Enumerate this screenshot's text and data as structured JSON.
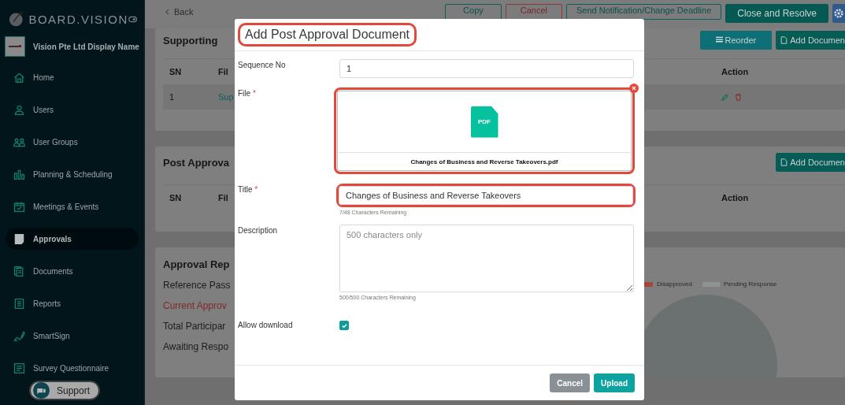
{
  "sidebar": {
    "brand": "BOARD.VISION",
    "org_name": "Vision Pte Ltd Display Name",
    "items": [
      {
        "label": "Home",
        "selected": false
      },
      {
        "label": "Users",
        "selected": false
      },
      {
        "label": "User Groups",
        "selected": false
      },
      {
        "label": "Planning & Scheduling",
        "selected": false
      },
      {
        "label": "Meetings & Events",
        "selected": false
      },
      {
        "label": "Approvals",
        "selected": true
      },
      {
        "label": "Documents",
        "selected": false
      },
      {
        "label": "Reports",
        "selected": false
      },
      {
        "label": "SmartSign",
        "selected": false
      },
      {
        "label": "Survey Questionnaire",
        "selected": false
      }
    ],
    "support_button": "Support"
  },
  "top_bar": {
    "back": "Back",
    "buttons": [
      {
        "label": "Copy",
        "kind": "outline"
      },
      {
        "label": "Cancel",
        "kind": "danger"
      },
      {
        "label": "Send Notification/Change Deadline",
        "kind": "outline"
      },
      {
        "label": "Close and Resolve",
        "kind": "solid"
      }
    ]
  },
  "supporting_documents": {
    "title": "Supporting",
    "buttons": [
      "Reorder",
      "Add Documen"
    ],
    "columns": [
      "SN",
      "Fil",
      "Action"
    ],
    "rows": [
      {
        "sn": "1",
        "file": "Sup"
      }
    ]
  },
  "post_approval_documents": {
    "title": "Post Approva",
    "button": "Add Documen",
    "columns": [
      "SN",
      "Fil",
      "Action"
    ]
  },
  "approval_report": {
    "title": "Approval Rep",
    "lines": [
      {
        "text": "Reference Pass",
        "kind": "normal"
      },
      {
        "text": "Current Approv",
        "kind": "alert"
      },
      {
        "text": "Total Participar",
        "kind": "normal"
      },
      {
        "text": "Awaiting Respo",
        "kind": "normal"
      }
    ],
    "legend": [
      {
        "label": "Disapproved",
        "color": "#a3473b"
      },
      {
        "label": "Pending Response",
        "color": "#8c9393"
      }
    ]
  },
  "modal": {
    "title": "Add Post Approval Document",
    "title_highlighted": true,
    "sequence": {
      "label": "Sequence No",
      "value": "1"
    },
    "file": {
      "label": "File",
      "required_mark": "*",
      "badge": "PDF",
      "file_name": "Changes of Business and Reverse Takeovers.pdf",
      "highlighted": true
    },
    "title_field": {
      "label": "Title",
      "required_mark": "*",
      "value": "Changes of Business and Reverse Takeovers",
      "hint": "7/48 Characters Remaining",
      "highlighted": true
    },
    "description": {
      "label": "Description",
      "placeholder": "500 characters only",
      "hint": "500/500 Characters Remaining"
    },
    "allow_download": {
      "label": "Allow download",
      "checked": true
    },
    "buttons": [
      {
        "label": "Cancel",
        "kind": "secondary"
      },
      {
        "label": "Upload",
        "kind": "primary"
      }
    ]
  }
}
